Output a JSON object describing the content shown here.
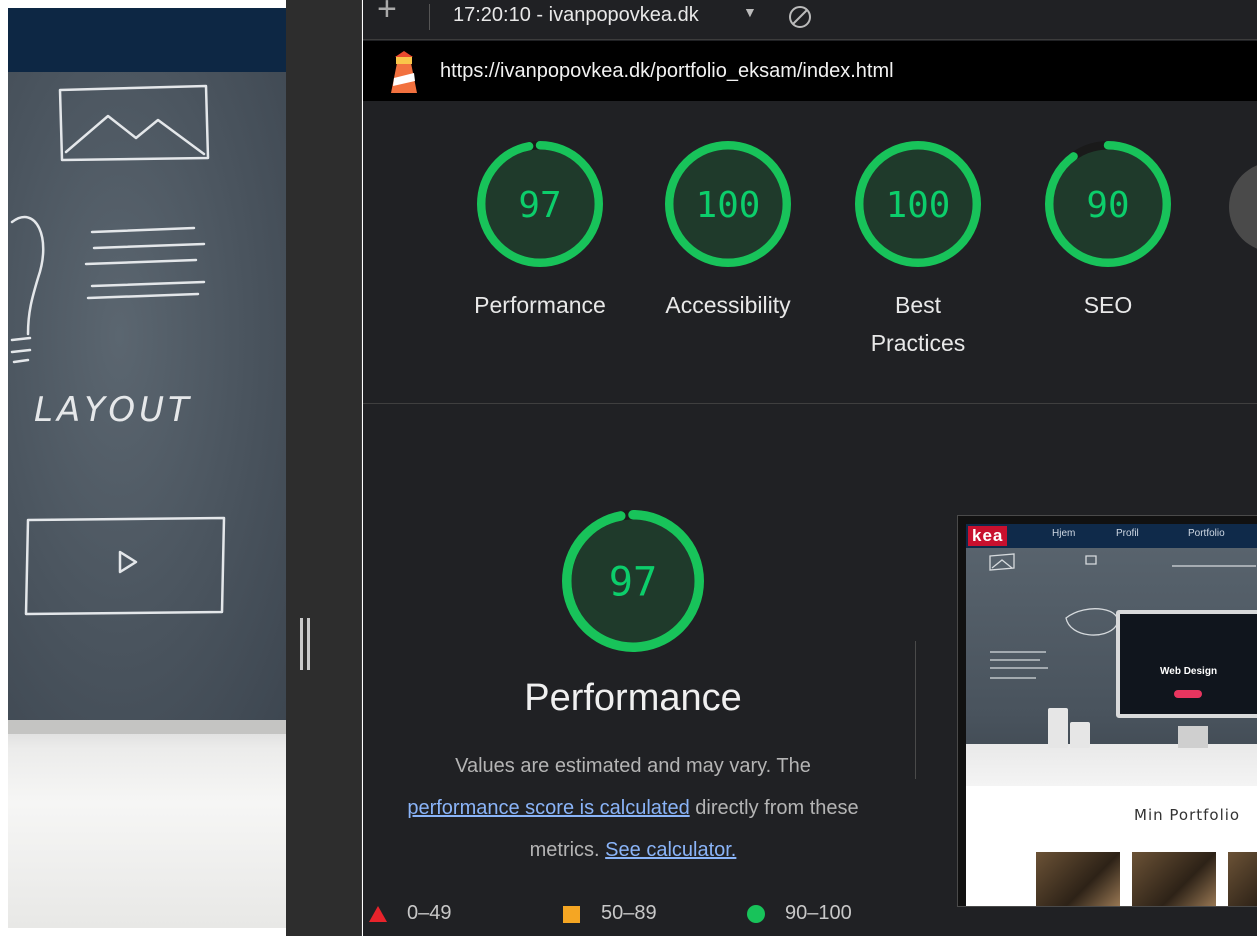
{
  "devtools": {
    "topbar": {
      "report_name": "17:20:10 - ivanpopovkea.dk"
    },
    "url": "https://ivanpopovkea.dk/portfolio_eksam/index.html"
  },
  "left_page": {
    "sketch_label": "LAYOUT"
  },
  "scores": [
    {
      "label": "Performance",
      "value": "97",
      "fraction": 0.97
    },
    {
      "label": "Accessibility",
      "value": "100",
      "fraction": 1.0
    },
    {
      "label": "Best Practices",
      "line1": "Best",
      "line2": "Practices",
      "value": "100",
      "fraction": 1.0
    },
    {
      "label": "SEO",
      "value": "90",
      "fraction": 0.9
    }
  ],
  "performance": {
    "score": "97",
    "fraction": 0.97,
    "title": "Performance",
    "desc_part1": "Values are estimated and may vary. The",
    "link_calc": "performance score is calculated",
    "desc_part2": "directly from these",
    "desc_part3": "metrics.",
    "link_calculator": "See calculator."
  },
  "legend": [
    {
      "range": "0–49",
      "shape": "triangle",
      "color": "#e8232b"
    },
    {
      "range": "50–89",
      "shape": "square",
      "color": "#f5a623"
    },
    {
      "range": "90–100",
      "shape": "circle",
      "color": "#18c35a"
    }
  ],
  "colors": {
    "pass": "#18c35a",
    "pass_fill": "#1f3a2b",
    "pass_text": "#0cce6b"
  },
  "thumbnail": {
    "logo": "kea",
    "nav": [
      "Hjem",
      "Profil",
      "Portfolio"
    ],
    "hero_title": "Web Design",
    "section_title": "Min Portfolio"
  }
}
